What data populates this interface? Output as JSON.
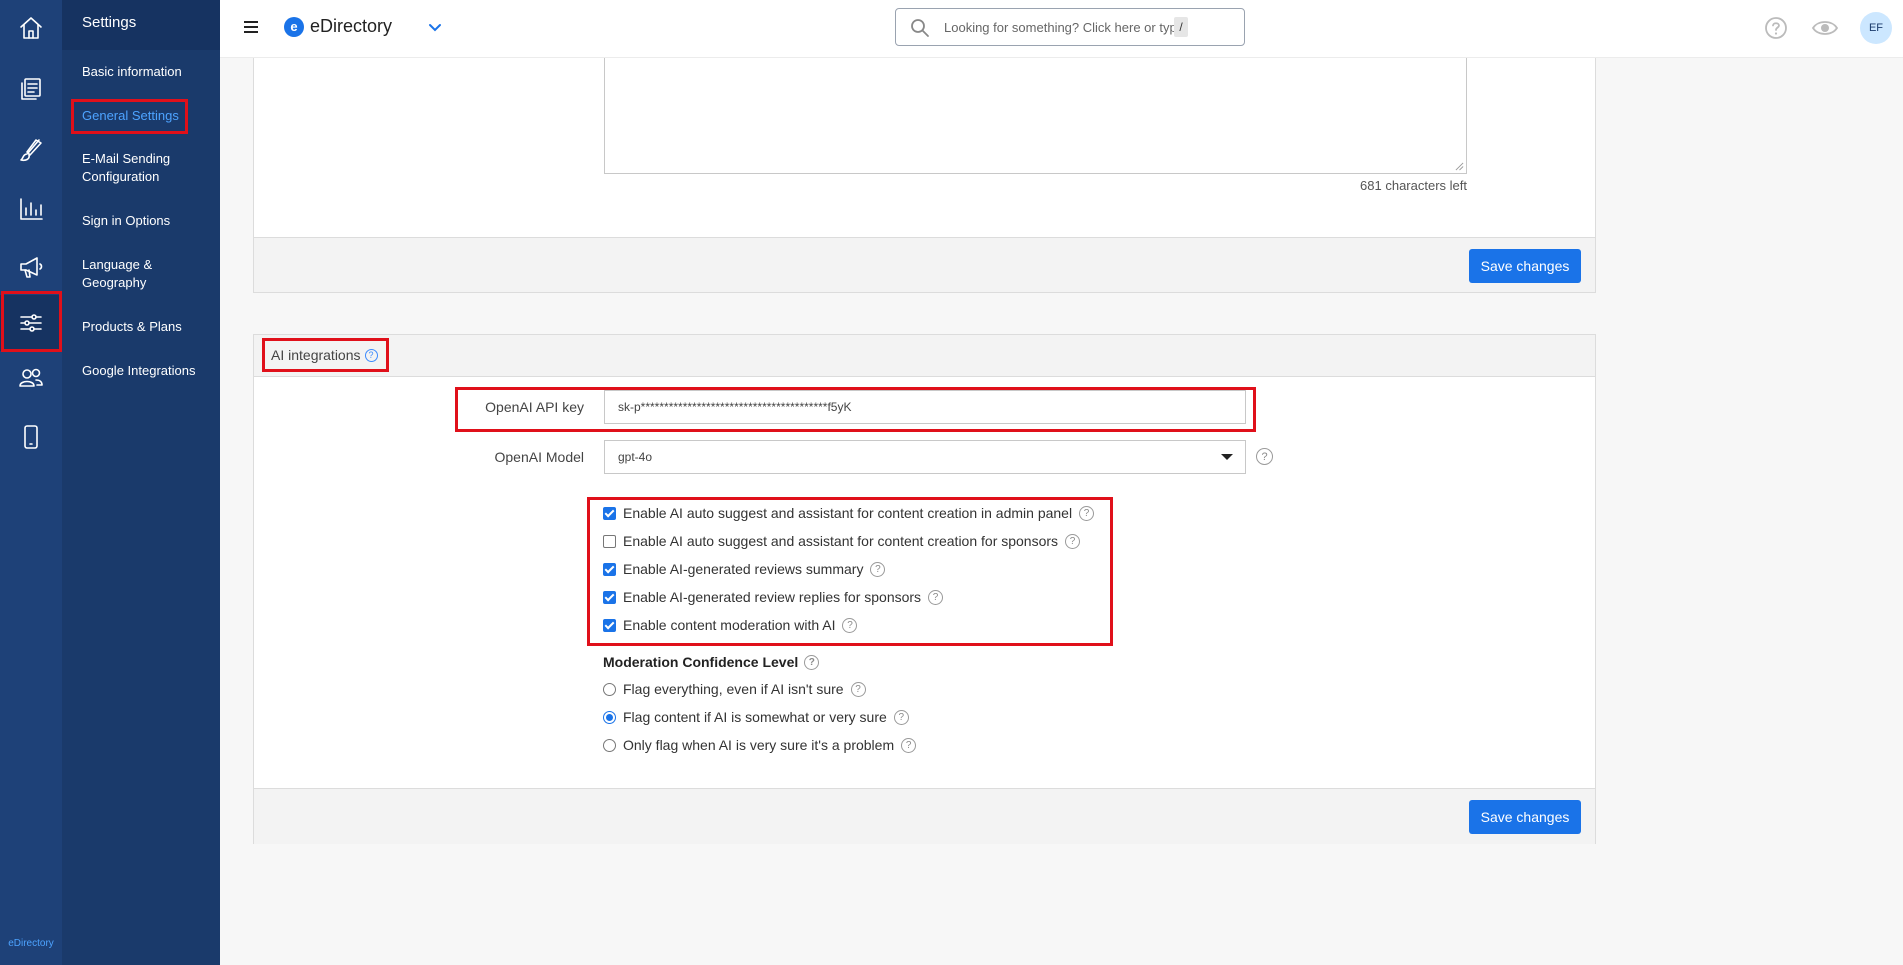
{
  "app": {
    "name": "eDirectory",
    "footer_brand": "eDirectory"
  },
  "rail": {
    "items": [
      {
        "icon": "home-icon"
      },
      {
        "icon": "content-icon"
      },
      {
        "icon": "design-brush-icon"
      },
      {
        "icon": "reports-chart-icon"
      },
      {
        "icon": "promote-megaphone-icon"
      },
      {
        "icon": "settings-sliders-icon",
        "active": true
      },
      {
        "icon": "users-icon"
      },
      {
        "icon": "mobile-icon"
      }
    ]
  },
  "settings_menu": {
    "title": "Settings",
    "items": [
      {
        "label": "Basic information"
      },
      {
        "label": "General Settings",
        "active": true
      },
      {
        "label": "E-Mail Sending Configuration"
      },
      {
        "label": "Sign in Options"
      },
      {
        "label": "Language & Geography"
      },
      {
        "label": "Products & Plans"
      },
      {
        "label": "Google Integrations"
      }
    ]
  },
  "topbar": {
    "search_placeholder": "Looking for something? Click here or type",
    "search_shortcut": "/",
    "avatar_initials": "EF"
  },
  "previous_section": {
    "chars_left": "681 characters left",
    "save_label": "Save changes"
  },
  "ai_section": {
    "title": "AI integrations",
    "api_key_label": "OpenAI API key",
    "api_key_value": "sk-p****************************************f5yK",
    "model_label": "OpenAI Model",
    "model_value": "gpt-4o",
    "checkboxes": [
      {
        "label": "Enable AI auto suggest and assistant for content creation in admin panel",
        "checked": true
      },
      {
        "label": "Enable AI auto suggest and assistant for content creation for sponsors",
        "checked": false
      },
      {
        "label": "Enable AI-generated reviews summary",
        "checked": true
      },
      {
        "label": "Enable AI-generated review replies for sponsors",
        "checked": true
      },
      {
        "label": "Enable content moderation with AI",
        "checked": true
      }
    ],
    "moderation_title": "Moderation Confidence Level",
    "moderation_options": [
      {
        "label": "Flag everything, even if AI isn't sure",
        "selected": false
      },
      {
        "label": "Flag content if AI is somewhat or very sure",
        "selected": true
      },
      {
        "label": "Only flag when AI is very sure it's a problem",
        "selected": false
      }
    ],
    "save_label": "Save changes"
  },
  "colors": {
    "accent": "#1a73e8",
    "rail_bg": "#1e4178",
    "menu_bg": "#1a3a6b",
    "highlight_box": "#e0101a"
  }
}
